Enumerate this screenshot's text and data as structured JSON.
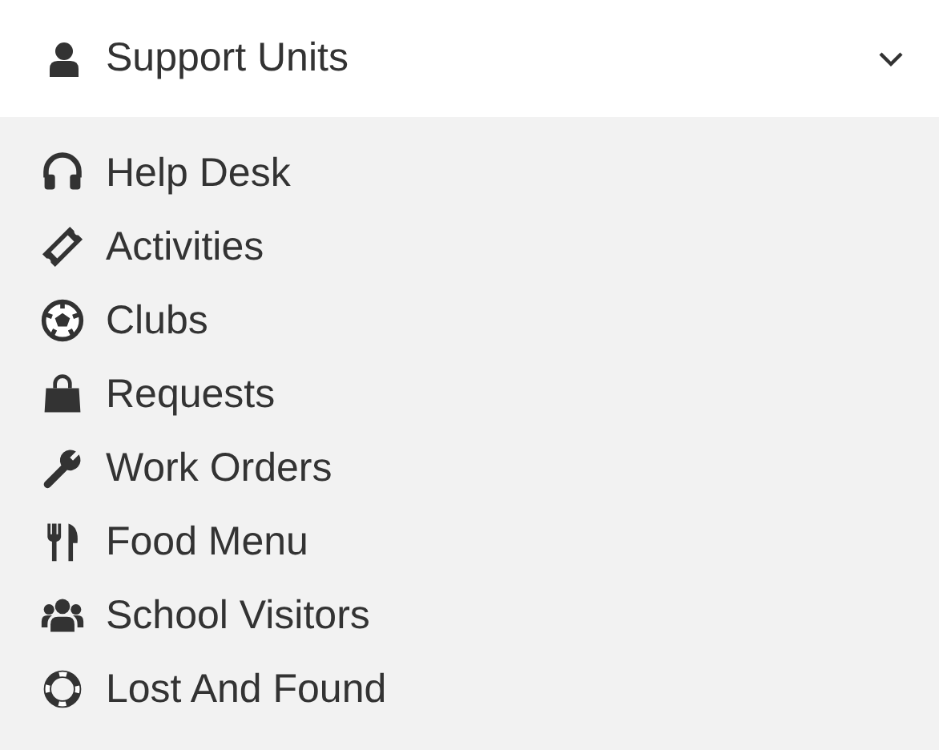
{
  "menu": {
    "title": "Support Units",
    "expanded": true,
    "items": [
      {
        "label": "Help Desk"
      },
      {
        "label": "Activities"
      },
      {
        "label": "Clubs"
      },
      {
        "label": "Requests"
      },
      {
        "label": "Work Orders"
      },
      {
        "label": "Food Menu"
      },
      {
        "label": "School Visitors"
      },
      {
        "label": "Lost And Found"
      }
    ]
  }
}
